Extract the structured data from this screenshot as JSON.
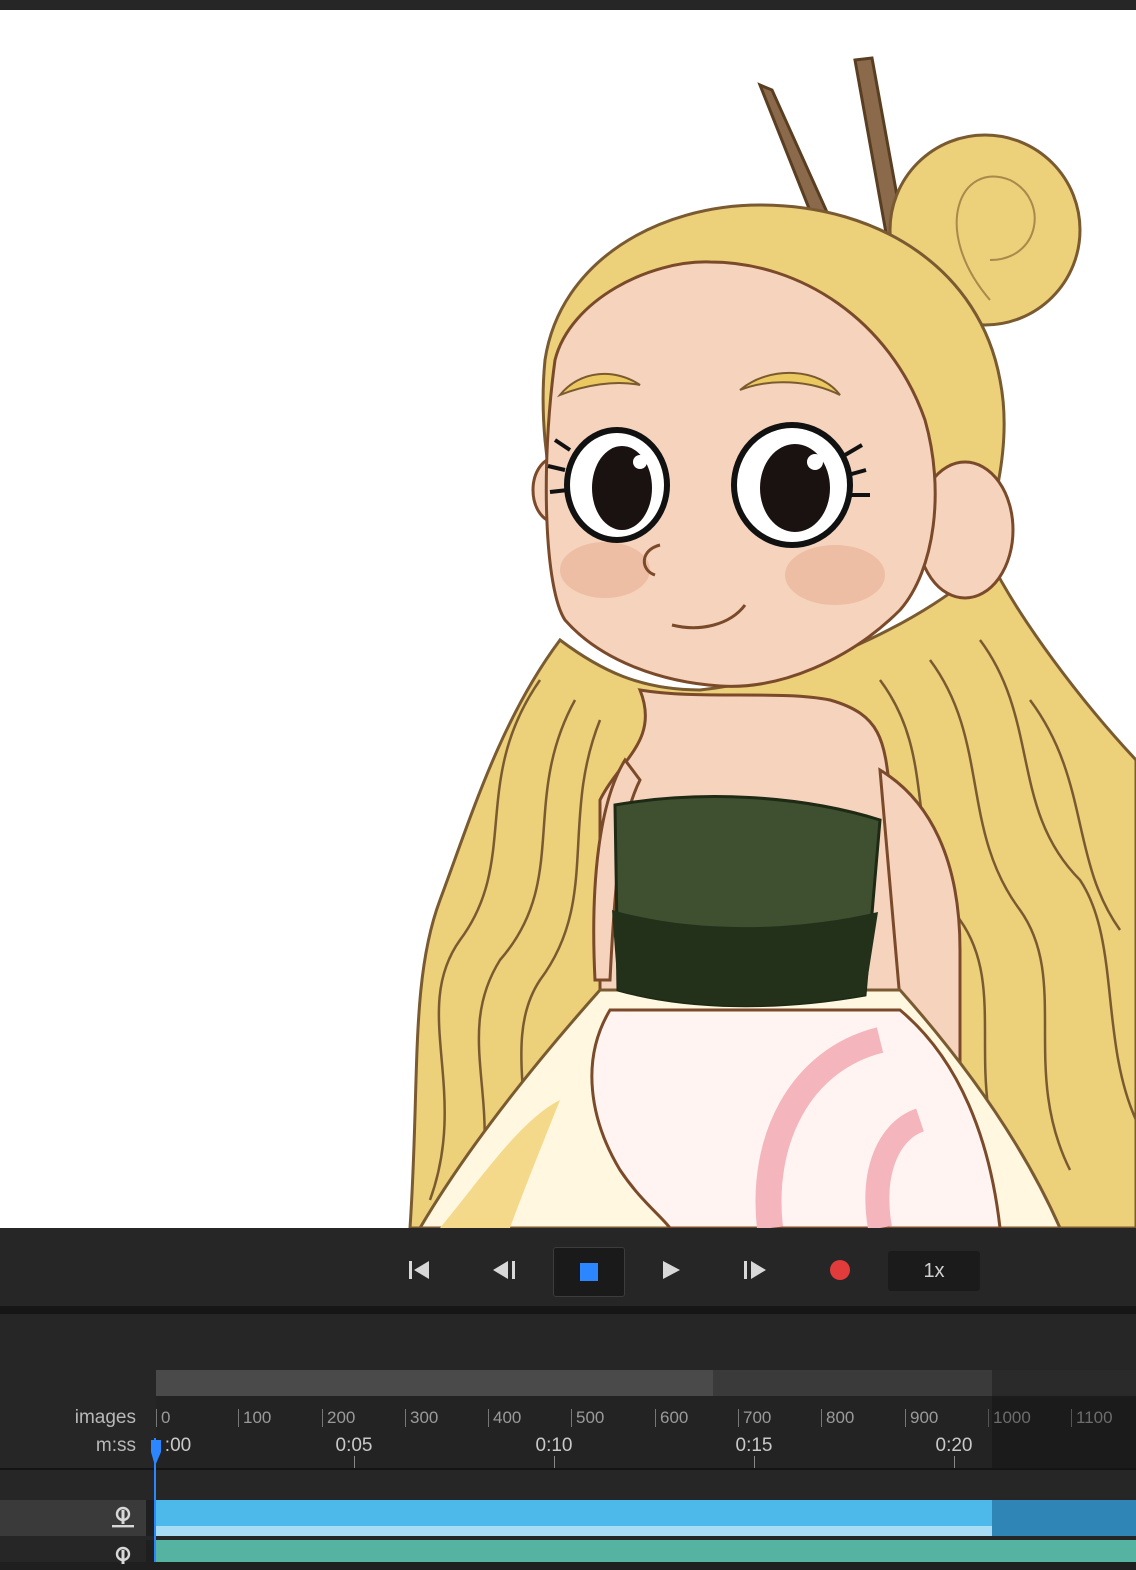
{
  "transport": {
    "buttons": [
      "go-to-start",
      "step-back",
      "stop",
      "play",
      "step-forward",
      "record"
    ],
    "speed_label": "1x",
    "accent_color": "#2b86ff",
    "record_color": "#e23b3b"
  },
  "timeline": {
    "row_labels": {
      "frames": "images",
      "time": "m:ss"
    },
    "frame_ticks": [
      "0",
      "100",
      "200",
      "300",
      "400",
      "500",
      "600",
      "700",
      "800",
      "900",
      "1000",
      "1100"
    ],
    "time_ticks": [
      ":00",
      "0:05",
      "0:10",
      "0:15",
      "0:20"
    ],
    "track_colors": {
      "audio_or_scene": "#4db8ea",
      "puppet": "#55b3a1"
    }
  },
  "icons": [
    "go-to-start-icon",
    "step-back-icon",
    "stop-icon",
    "play-icon",
    "step-forward-icon",
    "record-icon",
    "puppet-icon"
  ]
}
